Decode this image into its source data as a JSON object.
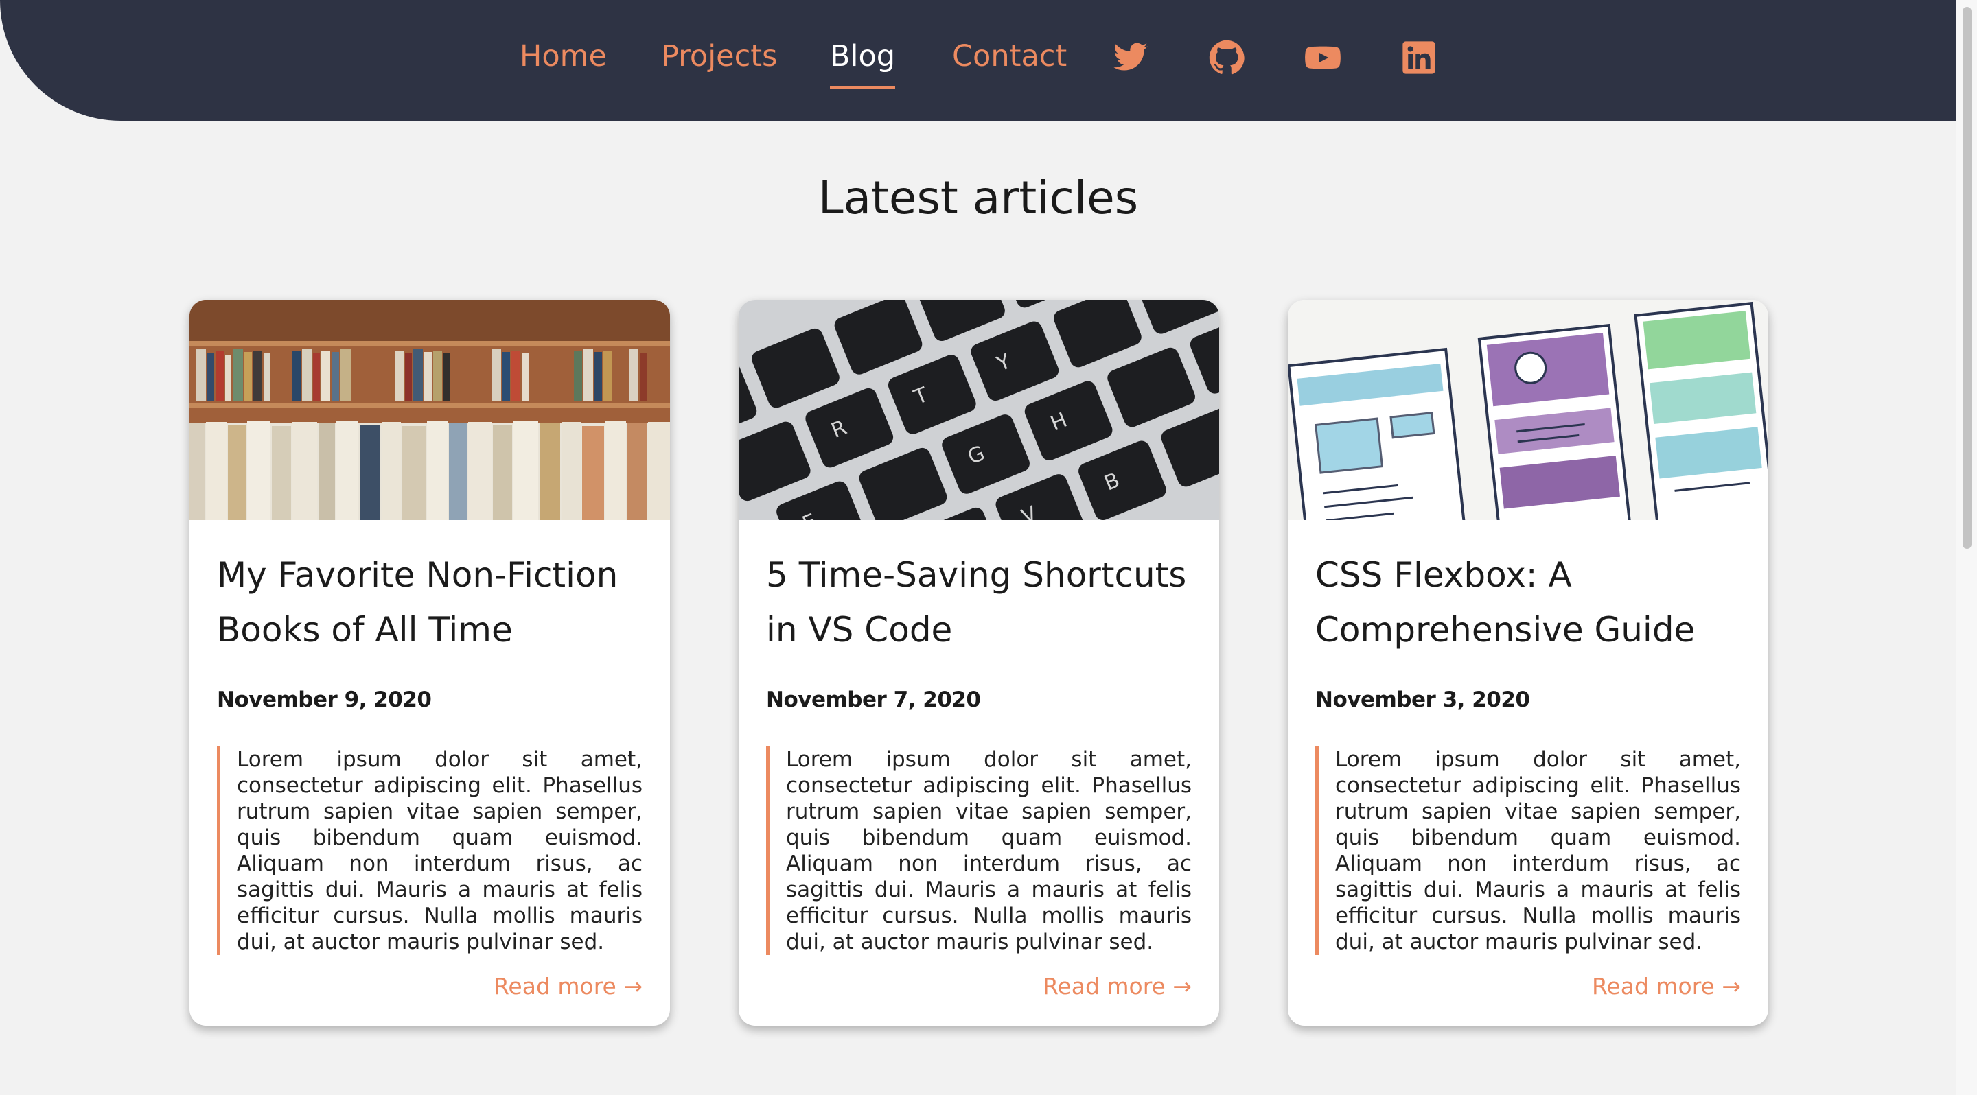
{
  "nav": {
    "links": [
      "Home",
      "Projects",
      "Blog",
      "Contact"
    ],
    "active": "Blog",
    "icons": [
      "twitter-icon",
      "github-icon",
      "youtube-icon",
      "linkedin-icon"
    ]
  },
  "colors": {
    "header_bg": "#2e3344",
    "accent": "#ec8a60",
    "page_bg": "#f2f2f2"
  },
  "page_title": "Latest articles",
  "articles": [
    {
      "image": "bookshelf-photo",
      "title": "My Favorite Non-Fiction Books of All Time",
      "date": "November 9, 2020",
      "excerpt": "Lorem ipsum dolor sit amet, consectetur adipiscing elit. Phasellus rutrum sapien vitae sapien semper, quis bibendum quam euismod. Aliquam non interdum risus, ac sagittis dui. Mauris a mauris at felis efficitur cursus. Nulla mollis mauris dui, at auctor mauris pulvinar sed.",
      "read_more": "Read more →"
    },
    {
      "image": "keyboard-photo",
      "title": "5 Time-Saving Shortcuts in VS Code",
      "date": "November 7, 2020",
      "excerpt": "Lorem ipsum dolor sit amet, consectetur adipiscing elit. Phasellus rutrum sapien vitae sapien semper, quis bibendum quam euismod. Aliquam non interdum risus, ac sagittis dui. Mauris a mauris at felis efficitur cursus. Nulla mollis mauris dui, at auctor mauris pulvinar sed.",
      "read_more": "Read more →"
    },
    {
      "image": "wireframe-sketch-photo",
      "title": "CSS Flexbox: A Comprehensive Guide",
      "date": "November 3, 2020",
      "excerpt": "Lorem ipsum dolor sit amet, consectetur adipiscing elit. Phasellus rutrum sapien vitae sapien semper, quis bibendum quam euismod. Aliquam non interdum risus, ac sagittis dui. Mauris a mauris at felis efficitur cursus. Nulla mollis mauris dui, at auctor mauris pulvinar sed.",
      "read_more": "Read more →"
    }
  ]
}
